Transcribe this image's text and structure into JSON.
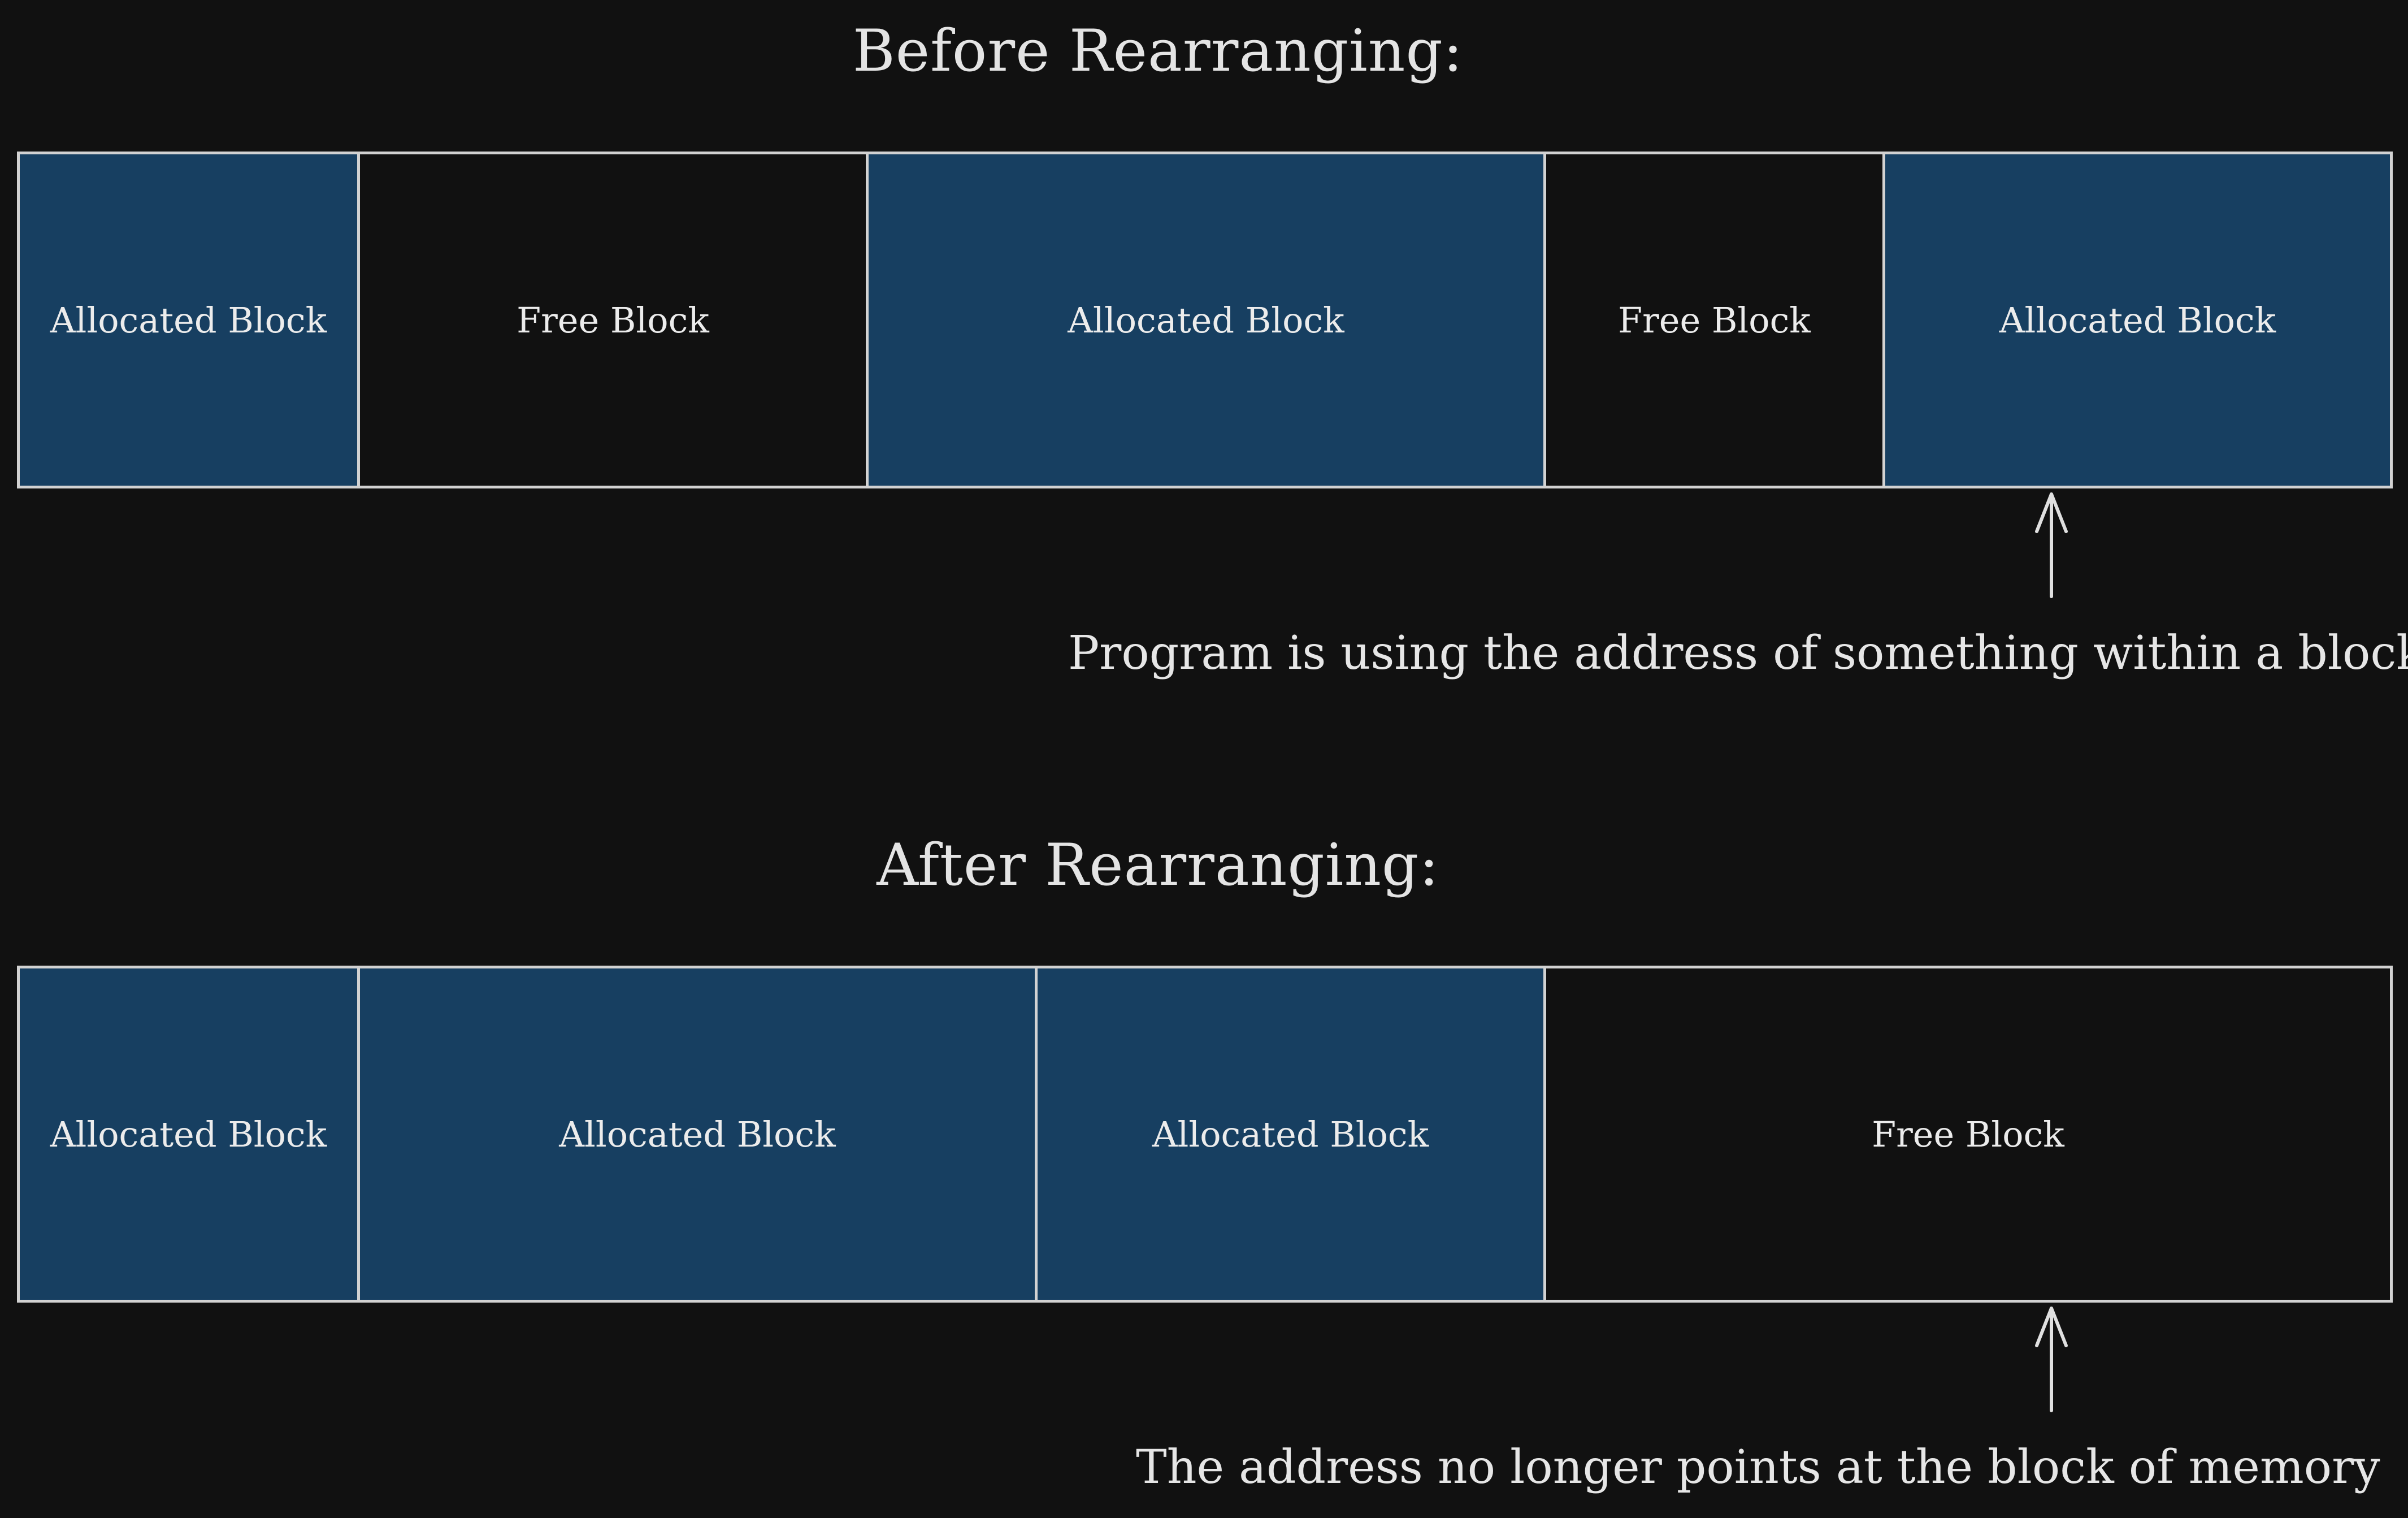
{
  "before": {
    "heading": "Before Rearranging:",
    "blocks": [
      {
        "label": "Allocated Block",
        "kind": "allocated",
        "size": 600
      },
      {
        "label": "Free Block",
        "kind": "free",
        "size": 900
      },
      {
        "label": "Allocated Block",
        "kind": "allocated",
        "size": 1200
      },
      {
        "label": "Free Block",
        "kind": "free",
        "size": 600
      },
      {
        "label": "Allocated Block",
        "kind": "allocated",
        "size": 900
      }
    ],
    "note": "Program is using the address of something within a block"
  },
  "after": {
    "heading": "After Rearranging:",
    "blocks": [
      {
        "label": "Allocated Block",
        "kind": "allocated",
        "size": 600
      },
      {
        "label": "Allocated Block",
        "kind": "allocated",
        "size": 1200
      },
      {
        "label": "Allocated Block",
        "kind": "allocated",
        "size": 900
      },
      {
        "label": "Free Block",
        "kind": "free",
        "size": 1500
      }
    ],
    "note": "The address no longer points at the block of memory"
  },
  "colors": {
    "background": "#111111",
    "allocated": "#173f61",
    "free": "#111111",
    "border": "#d2d2d2",
    "text": "#e6e6e6"
  }
}
